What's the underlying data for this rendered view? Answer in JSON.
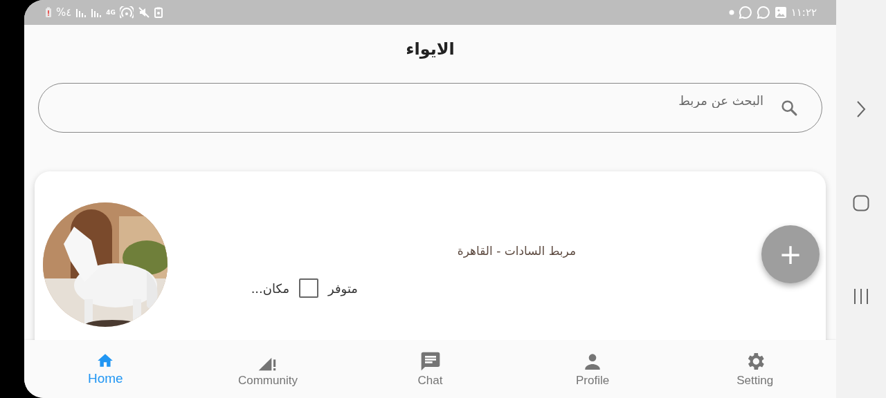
{
  "status_bar": {
    "battery_percent": "%٤",
    "network": "4G",
    "time": "١١:٢٢"
  },
  "app_bar": {
    "title": "الايواء"
  },
  "search": {
    "placeholder": "البحث عن مربط"
  },
  "cards": [
    {
      "kind": "picture",
      "title": "مربط السادات - القاهرة",
      "status_label": "متوفر",
      "checked": false,
      "location": "مكان..."
    }
  ],
  "fab": {
    "label": "+"
  },
  "bottom_nav": [
    {
      "label": "Setting",
      "kind": "setting",
      "selected": false
    },
    {
      "label": "Profile",
      "kind": "profile",
      "selected": false
    },
    {
      "label": "Chat",
      "kind": "chat",
      "selected": false
    },
    {
      "label": "Community",
      "kind": "community",
      "selected": false
    },
    {
      "label": "Home",
      "kind": "home",
      "selected": true
    }
  ]
}
